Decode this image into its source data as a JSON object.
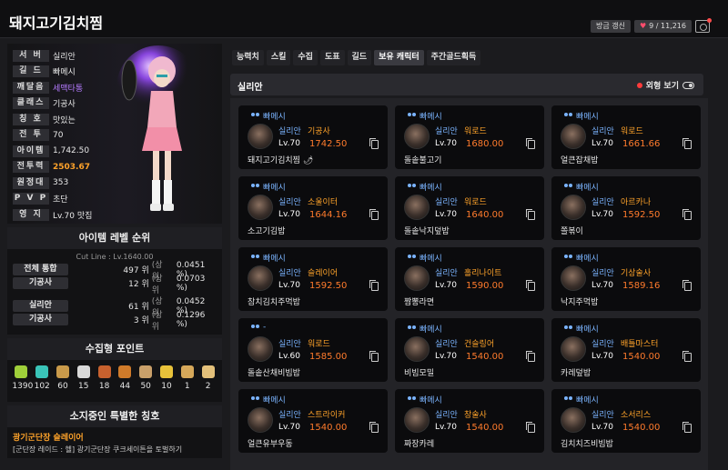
{
  "header": {
    "title": "돼지고기김치찜",
    "refresh_label": "방금 갱신",
    "likes": "9 / 11,216"
  },
  "profile": {
    "rows": [
      {
        "label": "서 버",
        "value": "실리안",
        "style": ""
      },
      {
        "label": "길 드",
        "value": "빠메시",
        "style": ""
      },
      {
        "label": "깨달음",
        "value": "세맥타통",
        "style": "purple"
      },
      {
        "label": "클래스",
        "value": "기공사",
        "style": ""
      },
      {
        "label": "칭 호",
        "value": "맛있는",
        "style": ""
      },
      {
        "label": "전 투",
        "value": "70",
        "style": ""
      },
      {
        "label": "아이템",
        "value": "1,742.50",
        "style": ""
      },
      {
        "label": "전투력",
        "value": "2503.67",
        "style": "orange"
      },
      {
        "label": "원정대",
        "value": "353",
        "style": ""
      },
      {
        "label": "P V P",
        "value": "초단",
        "style": ""
      },
      {
        "label": "영 지",
        "value": "Lv.70 맛집",
        "style": ""
      }
    ]
  },
  "ranking": {
    "title": "아이템 레벨 순위",
    "cutline": "Cut Line : Lv.1640.00",
    "rows": [
      {
        "tag": "전체 통합",
        "pos": "497 위",
        "sub": "(상위",
        "pct": "0.0451 %)"
      },
      {
        "tag": "기공사",
        "pos": "12 위",
        "sub": "(상위",
        "pct": "0.0703 %)"
      },
      {
        "tag": "실리안",
        "pos": "61 위",
        "sub": "(상위",
        "pct": "0.0452 %)"
      },
      {
        "tag": "기공사",
        "pos": "3 위",
        "sub": "(상위",
        "pct": "0.1296 %)"
      }
    ]
  },
  "collection": {
    "title": "수집형 포인트",
    "items": [
      {
        "icon": "seed-icon",
        "color": "#9fcf3a",
        "value": "1390"
      },
      {
        "icon": "island-heart-icon",
        "color": "#3ac4b8",
        "value": "102"
      },
      {
        "icon": "masterpiece-icon",
        "color": "#c99a4a",
        "value": "60"
      },
      {
        "icon": "giant-heart-icon",
        "color": "#d9d9d9",
        "value": "15"
      },
      {
        "icon": "ignea-token-icon",
        "color": "#c7612e",
        "value": "18"
      },
      {
        "icon": "adventure-book-icon",
        "color": "#d07b2a",
        "value": "44"
      },
      {
        "icon": "voyage-icon",
        "color": "#c9a06a",
        "value": "50"
      },
      {
        "icon": "world-tree-leaf-icon",
        "color": "#e8c23a",
        "value": "10"
      },
      {
        "icon": "orpheus-star-icon",
        "color": "#d6a85a",
        "value": "1"
      },
      {
        "icon": "sheet-music-icon",
        "color": "#e3c07a",
        "value": "2"
      }
    ]
  },
  "titles": {
    "title": "소지중인 특별한 칭호",
    "name": "광기군단장 슬레이어",
    "desc": "[군단장 레이드 : 헬] 광기군단장 쿠크세이튼을 토벌하기"
  },
  "tabs": [
    "능력치",
    "스킬",
    "수집",
    "도표",
    "길드",
    "보유 캐릭터",
    "주간골드획득"
  ],
  "server_bar": {
    "name": "실리안",
    "look_label": "외형 보기"
  },
  "characters": [
    {
      "guild": "빠메시",
      "server": "실리안",
      "class": "기공사",
      "lv": "Lv.70",
      "ilvl": "1742.50",
      "name": "돼지고기김치찜 🌶"
    },
    {
      "guild": "빠메시",
      "server": "실리안",
      "class": "워로드",
      "lv": "Lv.70",
      "ilvl": "1680.00",
      "name": "돌솥불고기"
    },
    {
      "guild": "빠메시",
      "server": "실리안",
      "class": "워로드",
      "lv": "Lv.70",
      "ilvl": "1661.66",
      "name": "얼큰잡채밥"
    },
    {
      "guild": "빠메시",
      "server": "실리안",
      "class": "소울이터",
      "lv": "Lv.70",
      "ilvl": "1644.16",
      "name": "소고기김밥"
    },
    {
      "guild": "빠메시",
      "server": "실리안",
      "class": "워로드",
      "lv": "Lv.70",
      "ilvl": "1640.00",
      "name": "돌솥낙지덮밥"
    },
    {
      "guild": "빠메시",
      "server": "실리안",
      "class": "아르카나",
      "lv": "Lv.70",
      "ilvl": "1592.50",
      "name": "쫄볶이"
    },
    {
      "guild": "빠메시",
      "server": "실리안",
      "class": "슬레이어",
      "lv": "Lv.70",
      "ilvl": "1592.50",
      "name": "참치김치주먹밥"
    },
    {
      "guild": "빠메시",
      "server": "실리안",
      "class": "홀리나이트",
      "lv": "Lv.70",
      "ilvl": "1590.00",
      "name": "짬뽕라면"
    },
    {
      "guild": "빠메시",
      "server": "실리안",
      "class": "기상술사",
      "lv": "Lv.70",
      "ilvl": "1589.16",
      "name": "낙지주먹밥"
    },
    {
      "guild": "-",
      "server": "실리안",
      "class": "워로드",
      "lv": "Lv.60",
      "ilvl": "1585.00",
      "name": "돌솥산채비빔밥"
    },
    {
      "guild": "빠메시",
      "server": "실리안",
      "class": "건슬링어",
      "lv": "Lv.70",
      "ilvl": "1540.00",
      "name": "비빔모밀"
    },
    {
      "guild": "빠메시",
      "server": "실리안",
      "class": "배틀마스터",
      "lv": "Lv.70",
      "ilvl": "1540.00",
      "name": "카레덮밥"
    },
    {
      "guild": "빠메시",
      "server": "실리안",
      "class": "스트라이커",
      "lv": "Lv.70",
      "ilvl": "1540.00",
      "name": "얼큰유부우동"
    },
    {
      "guild": "빠메시",
      "server": "실리안",
      "class": "창술사",
      "lv": "Lv.70",
      "ilvl": "1540.00",
      "name": "짜장카레"
    },
    {
      "guild": "빠메시",
      "server": "실리안",
      "class": "소서리스",
      "lv": "Lv.70",
      "ilvl": "1540.00",
      "name": "김치치즈비빔밥"
    }
  ]
}
